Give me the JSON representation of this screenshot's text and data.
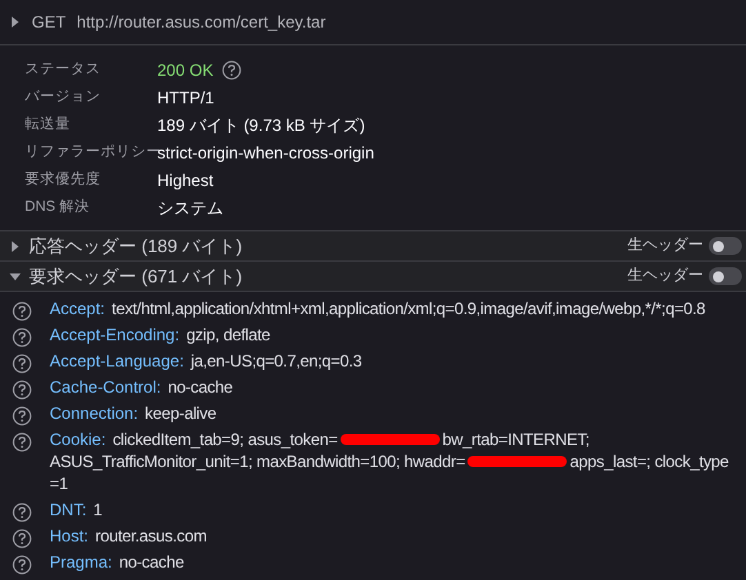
{
  "request": {
    "method": "GET",
    "url": "http://router.asus.com/cert_key.tar",
    "expanded": false
  },
  "summary": [
    {
      "label": "ステータス",
      "value": "200 OK",
      "kind": "status"
    },
    {
      "label": "バージョン",
      "value": "HTTP/1",
      "kind": "text"
    },
    {
      "label": "転送量",
      "value": "189 バイト (9.73 kB サイズ)",
      "kind": "text"
    },
    {
      "label": "リファラーポリシー",
      "value": "strict-origin-when-cross-origin",
      "kind": "text"
    },
    {
      "label": "要求優先度",
      "value": "Highest",
      "kind": "text"
    },
    {
      "label": "DNS 解決",
      "value": "システム",
      "kind": "text"
    }
  ],
  "sections": [
    {
      "title": "応答ヘッダー (189 バイト)",
      "expanded": false,
      "raw_label": "生ヘッダー",
      "raw_on": false
    },
    {
      "title": "要求ヘッダー (671 バイト)",
      "expanded": true,
      "raw_label": "生ヘッダー",
      "raw_on": false,
      "headers": [
        {
          "name": "Accept:",
          "lines": [
            [
              {
                "kind": "text",
                "text": "text/html,application/xhtml+xml,application/xml;q=0.9,image/avif,image/webp,*/*;q=0.8"
              }
            ]
          ]
        },
        {
          "name": "Accept-Encoding:",
          "lines": [
            [
              {
                "kind": "text",
                "text": "gzip, deflate"
              }
            ]
          ]
        },
        {
          "name": "Accept-Language:",
          "lines": [
            [
              {
                "kind": "text",
                "text": "ja,en-US;q=0.7,en;q=0.3"
              }
            ]
          ]
        },
        {
          "name": "Cache-Control:",
          "lines": [
            [
              {
                "kind": "text",
                "text": "no-cache"
              }
            ]
          ]
        },
        {
          "name": "Connection:",
          "lines": [
            [
              {
                "kind": "text",
                "text": "keep-alive"
              }
            ]
          ]
        },
        {
          "name": "Cookie:",
          "lines": [
            [
              {
                "kind": "text",
                "text": "clickedItem_tab=9; asus_token="
              },
              {
                "kind": "redacted"
              },
              {
                "kind": "text",
                "text": "bw_rtab=INTERNET;"
              }
            ],
            [
              {
                "kind": "text",
                "text": "ASUS_TrafficMonitor_unit=1; maxBandwidth=100; hwaddr="
              },
              {
                "kind": "redacted"
              },
              {
                "kind": "text",
                "text": "apps_last=; clock_type"
              }
            ],
            [
              {
                "kind": "text",
                "text": "=1"
              }
            ]
          ]
        },
        {
          "name": "DNT:",
          "lines": [
            [
              {
                "kind": "text",
                "text": "1"
              }
            ]
          ]
        },
        {
          "name": "Host:",
          "lines": [
            [
              {
                "kind": "text",
                "text": "router.asus.com"
              }
            ]
          ]
        },
        {
          "name": "Pragma:",
          "lines": [
            [
              {
                "kind": "text",
                "text": "no-cache"
              }
            ]
          ]
        }
      ]
    }
  ]
}
